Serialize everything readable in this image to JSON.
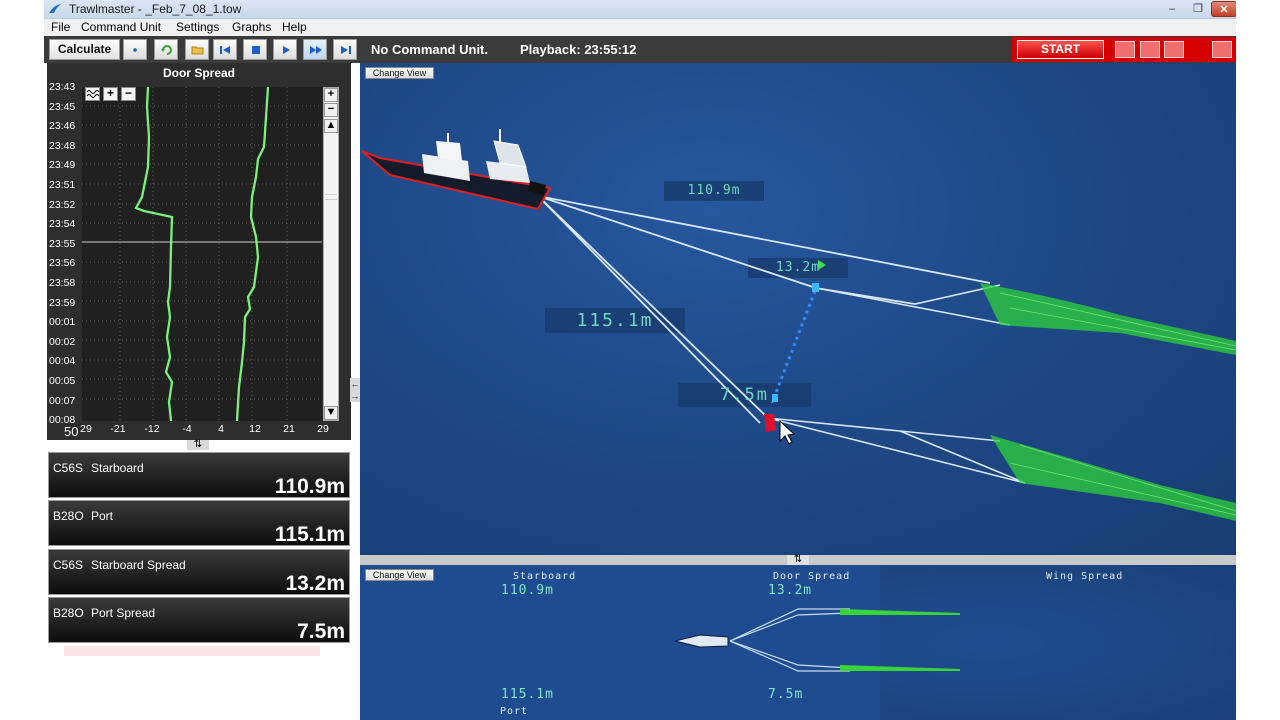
{
  "window": {
    "title": "Trawlmaster - _Feb_7_08_1.tow"
  },
  "menu": [
    "File",
    "Command Unit",
    "Settings",
    "Graphs",
    "Help"
  ],
  "toolbar": {
    "calculate_label": "Calculate",
    "command_unit_status": "No Command Unit.",
    "playback_status": "Playback: 23:55:12",
    "start_label": "START"
  },
  "graph": {
    "title": "Door Spread",
    "time_labels": [
      "23:43",
      "23:45",
      "23:46",
      "23:48",
      "23:49",
      "23:51",
      "23:52",
      "23:54",
      "23:55",
      "23:56",
      "23:58",
      "23:59",
      "00:01",
      "00:02",
      "00:04",
      "00:05",
      "00:07",
      "00:08"
    ],
    "x_labels": [
      "29",
      "-21",
      "-12",
      "-4",
      "4",
      "12",
      "21",
      "29"
    ],
    "x_prefix": "50",
    "line_color": "#7cf07c"
  },
  "readouts": [
    {
      "code": "C56S",
      "name": "Starboard",
      "value": "110.9m"
    },
    {
      "code": "B28O",
      "name": "Port",
      "value": "115.1m"
    },
    {
      "code": "C56S",
      "name": "Starboard Spread",
      "value": "13.2m"
    },
    {
      "code": "B28O",
      "name": "Port Spread",
      "value": "7.5m"
    }
  ],
  "view3d": {
    "change_view_label": "Change View",
    "labels": {
      "starboard_warp": "110.9m",
      "port_warp": "115.1m",
      "starboard_spread": "13.2m",
      "port_spread": "7.5m"
    }
  },
  "topview": {
    "change_view_label": "Change View",
    "starboard_label": "Starboard",
    "door_spread_label": "Door Spread",
    "wing_spread_label": "Wing Spread",
    "port_label": "Port",
    "starboard_value": "110.9m",
    "door_spread_top": "13.2m",
    "port_value": "115.1m",
    "door_spread_bottom": "7.5m"
  }
}
